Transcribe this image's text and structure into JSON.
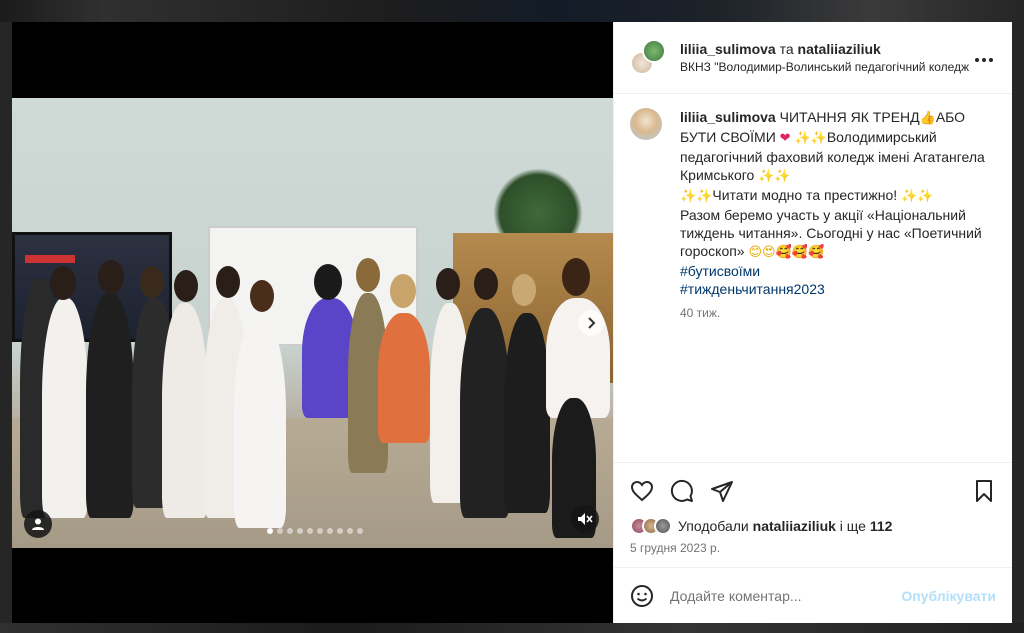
{
  "header": {
    "user1": "liliia_sulimova",
    "joiner": "та",
    "user2": "nataliiaziliuk",
    "location": "ВКНЗ \"Володимир-Волинський педагогічний коледж",
    "more_icon": "more-horizontal-icon"
  },
  "caption": {
    "username": "liliia_sulimova",
    "line1": "ЧИТАННЯ ЯК ТРЕНД",
    "line1_emoji": "👍",
    "line1b": "АБО БУТИ СВОЇМИ",
    "heart_emoji": "❤",
    "sparkles": "✨✨",
    "line2": "Володимирський педагогічний фаховий коледж імені Агатангела Кримського",
    "line3": "Читати модно та престижно!",
    "line4": "Разом беремо участь у акції «Національний тиждень читання». Сьогодні у нас «Поетичний гороскоп»",
    "faces": "😊😍🥰🥰🥰",
    "hashtags": [
      "#бутисвоїми",
      "#тижденьчитання2023"
    ],
    "time_ago": "40 тиж."
  },
  "media": {
    "slide_count": 10,
    "active_slide": 0,
    "next_icon": "chevron-right-icon",
    "tag_icon": "user-tag-icon",
    "mute_icon": "muted-speaker-icon"
  },
  "actions": {
    "like_icon": "heart-icon",
    "comment_icon": "comment-icon",
    "share_icon": "send-icon",
    "save_icon": "bookmark-icon"
  },
  "likes": {
    "prefix": "Уподобали",
    "user": "nataliiaziliuk",
    "and": "і ще",
    "count": "112"
  },
  "post_date": "5 грудня 2023 р.",
  "comment": {
    "placeholder": "Додайте коментар...",
    "publish_label": "Опублікувати",
    "emoji_icon": "smiley-icon"
  }
}
